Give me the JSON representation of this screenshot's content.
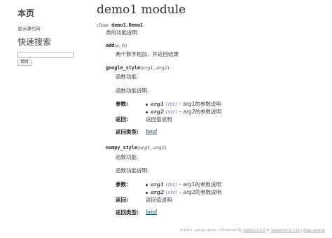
{
  "sidebar": {
    "title": "本页",
    "show_source": "显示源代码",
    "search_title": "快速搜索",
    "go_button": "转向"
  },
  "module": {
    "title": "demo1 module",
    "class_kw": "class",
    "class_name": "demo1.Demo1",
    "class_desc": "类的功能说明",
    "add": {
      "name": "add",
      "params": "a, b",
      "desc": "两个数字相加，并返回结果"
    },
    "google_style": {
      "name": "google_style",
      "params": "arg1, arg2",
      "func_label": "函数功能.",
      "func_desc": "函数功能说明.",
      "params_label": "参数:",
      "p1_name": "arg1",
      "p1_type": "(int)",
      "p1_desc": "– arg1的参数说明",
      "p2_name": "arg2",
      "p2_type": "(str)",
      "p2_desc": "– arg2的参数说明",
      "returns_label": "返回:",
      "returns_desc": "返回值说明",
      "rtype_label": "返回类型:",
      "rtype_value": "bool"
    },
    "numpy_style": {
      "name": "numpy_style",
      "params": "arg1, arg2",
      "func_label": "函数功能.",
      "func_desc": "函数功能说明.",
      "params_label": "参数:",
      "p1_name": "arg1",
      "p1_type": "(int)",
      "p1_desc": "– arg1的参数说明",
      "p2_name": "arg2",
      "p2_type": "(str)",
      "p2_desc": "– arg2的参数说明",
      "returns_label": "返回:",
      "returns_desc": "返回值说明",
      "rtype_label": "返回类型:",
      "rtype_value": "bool"
    }
  },
  "footer": {
    "copyright": "©2018, sphinx demo. | Powered by",
    "sphinx": "Sphinx 1.5.6",
    "and": " & ",
    "alabaster": "Alabaster 0.7.10",
    "sep": " | ",
    "page_source": "Page source"
  }
}
